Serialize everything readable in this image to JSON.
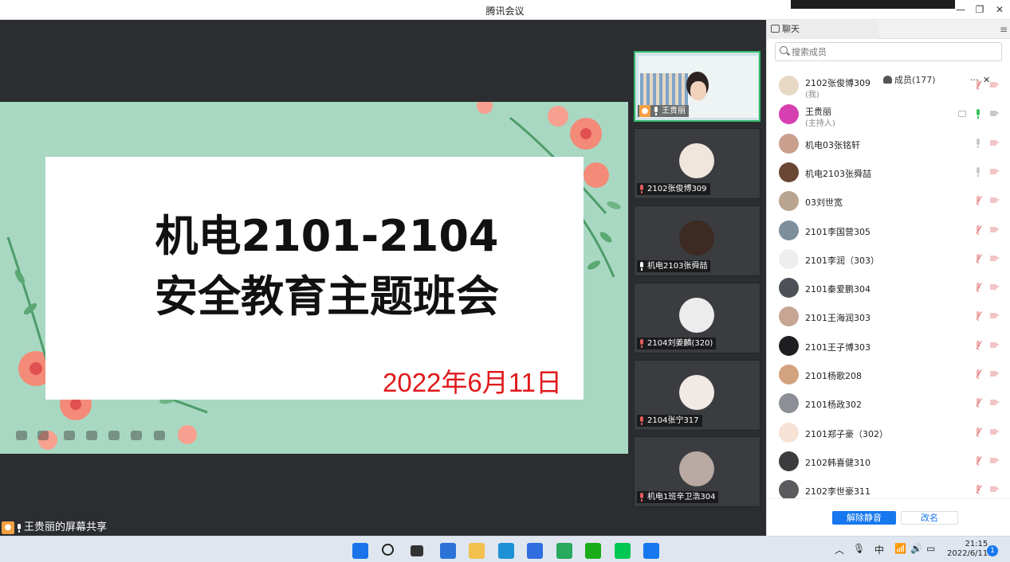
{
  "window": {
    "title": "腾讯会议",
    "controls": {
      "minimize": "—",
      "restore": "❐",
      "close": "✕"
    }
  },
  "slide": {
    "title_line1": "机电2101-2104",
    "title_line2": "安全教育主题班会",
    "date": "2022年6月11日"
  },
  "share_label": "王贵丽的屏幕共享",
  "gallery": [
    {
      "name": "王贵丽",
      "host": true,
      "mic": "on",
      "avatar_color": "#e9d4c4"
    },
    {
      "name": "2102张俊博309",
      "mic": "off",
      "avatar_color": "#efe6dc"
    },
    {
      "name": "机电2103张舜喆",
      "mic": "on",
      "avatar_color": "#3d2a22"
    },
    {
      "name": "2104刘姜麟(320)",
      "mic": "off",
      "avatar_color": "#ececec"
    },
    {
      "name": "2104张宁317",
      "mic": "off",
      "avatar_color": "#f1e9e4"
    },
    {
      "name": "机电1班辛卫浩304",
      "mic": "off",
      "avatar_color": "#b8a9a2"
    }
  ],
  "panel": {
    "tab_chat": "聊天",
    "tab_members": "成员(177)",
    "more": "···",
    "close": "✕",
    "search_placeholder": "搜索成员",
    "members": [
      {
        "name": "2102张俊博309",
        "sub": "(我)",
        "mic": "muted",
        "cam": "off",
        "avatar_color": "#e8d9c5"
      },
      {
        "name": "王贵丽",
        "sub": "(主持人)",
        "mic": "active",
        "cam": "normal",
        "share": true,
        "avatar_color": "#d63fb0"
      },
      {
        "name": "机电03张铭轩",
        "mic": "normal",
        "cam": "off",
        "avatar_color": "#c9a08e"
      },
      {
        "name": "机电2103张舜喆",
        "mic": "normal",
        "cam": "off",
        "avatar_color": "#6a4734"
      },
      {
        "name": "03刘世宽",
        "mic": "muted",
        "cam": "off",
        "avatar_color": "#b9a48f"
      },
      {
        "name": "2101李国营305",
        "mic": "muted",
        "cam": "off",
        "avatar_color": "#7e8f9c"
      },
      {
        "name": "2101李润（303）",
        "mic": "muted",
        "cam": "off",
        "avatar_color": "#eeeeee"
      },
      {
        "name": "2101秦爱鹏304",
        "mic": "muted",
        "cam": "off",
        "avatar_color": "#4d5057"
      },
      {
        "name": "2101王海润303",
        "mic": "muted",
        "cam": "off",
        "avatar_color": "#c7a593"
      },
      {
        "name": "2101王子博303",
        "mic": "muted",
        "cam": "off",
        "avatar_color": "#1f1f22"
      },
      {
        "name": "2101杨歌208",
        "mic": "muted",
        "cam": "off",
        "avatar_color": "#d3a27f"
      },
      {
        "name": "2101杨政302",
        "mic": "muted",
        "cam": "off",
        "avatar_color": "#8c8f96"
      },
      {
        "name": "2101郑子豪（302）",
        "mic": "muted",
        "cam": "off",
        "avatar_color": "#f7e2d6"
      },
      {
        "name": "2102韩喜健310",
        "mic": "muted",
        "cam": "off",
        "avatar_color": "#3c3c3f"
      },
      {
        "name": "2102李世豪311",
        "mic": "muted",
        "cam": "off",
        "avatar_color": "#5b5b5e"
      }
    ],
    "btn_unmute": "解除静音",
    "btn_rename": "改名"
  },
  "taskbar": {
    "tray_lang": "中",
    "time": "21:15",
    "date": "2022/6/11",
    "notifications": "1",
    "apps": [
      {
        "name": "start",
        "color": "#1a73e8"
      },
      {
        "name": "search",
        "color": "#222222"
      },
      {
        "name": "task-view",
        "color": "#333333"
      },
      {
        "name": "widgets",
        "color": "#2b72d6"
      },
      {
        "name": "file-explorer",
        "color": "#f2c14e"
      },
      {
        "name": "edge",
        "color": "#1e90d6"
      },
      {
        "name": "meeting-app",
        "color": "#2f6de0"
      },
      {
        "name": "store",
        "color": "#27a95e"
      },
      {
        "name": "wechat",
        "color": "#1aad19"
      },
      {
        "name": "iqiyi",
        "color": "#00c853"
      },
      {
        "name": "tencent-meeting",
        "color": "#1677ee"
      }
    ]
  }
}
